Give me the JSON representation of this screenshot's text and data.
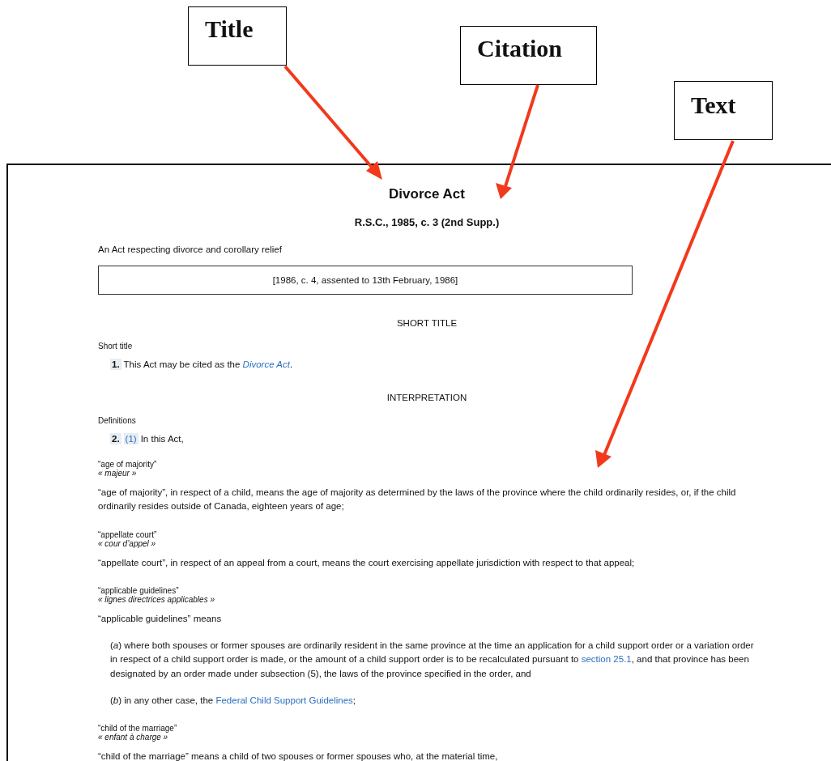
{
  "callouts": [
    {
      "label": "Title"
    },
    {
      "label": "Citation"
    },
    {
      "label": "Text"
    }
  ],
  "document": {
    "title": "Divorce Act",
    "citation": "R.S.C., 1985, c. 3 (2nd Supp.)",
    "long_title": "An Act respecting divorce and corollary relief",
    "assent": "[1986, c. 4, assented to 13th February, 1986]",
    "sections": [
      {
        "heading": "SHORT TITLE",
        "items": [
          {
            "kind": "note",
            "text": "Short title"
          },
          {
            "kind": "provision",
            "number": "1.",
            "parts": [
              {
                "kind": "plain",
                "text": "This Act may be cited as the "
              },
              {
                "kind": "link",
                "italic": true,
                "text": "Divorce Act"
              },
              {
                "kind": "plain",
                "text": "."
              }
            ]
          }
        ]
      },
      {
        "heading": "INTERPRETATION",
        "items": [
          {
            "kind": "note",
            "text": "Definitions"
          },
          {
            "kind": "provision",
            "number": "2.",
            "subsection": "(1)",
            "parts": [
              {
                "kind": "plain",
                "text": "In this Act,"
              }
            ]
          },
          {
            "kind": "definition",
            "term": "“age of majority”",
            "french": "« majeur »",
            "parts": [
              {
                "kind": "plain",
                "text": "“age of majority”, in respect of a child, means the age of majority as determined by the laws of the province where the child ordinarily resides, or, if the child ordinarily resides outside of Canada, eighteen years of age;"
              }
            ]
          },
          {
            "kind": "definition",
            "term": "“appellate court”",
            "french": "« cour d’appel »",
            "parts": [
              {
                "kind": "plain",
                "text": "“appellate court”, in respect of an appeal from a court, means the court exercising appellate jurisdiction with respect to that appeal;"
              }
            ]
          },
          {
            "kind": "definition",
            "term": "“applicable guidelines”",
            "french": "« lignes directrices applicables »",
            "parts": [
              {
                "kind": "plain",
                "text": "“applicable guidelines” means"
              }
            ]
          },
          {
            "kind": "paragraph",
            "parts": [
              {
                "kind": "plain",
                "text": "(*a*) where both spouses or former spouses are ordinarily resident in the same province at the time an application for a child support order or a variation order in respect of a child support order is made, or the amount of a child support order is to be recalculated pursuant to "
              },
              {
                "kind": "link",
                "italic": false,
                "text": "section 25.1"
              },
              {
                "kind": "plain",
                "text": ", and that province has been designated by an order made under subsection (5), the laws of the province specified in the order, and"
              }
            ]
          },
          {
            "kind": "paragraph",
            "parts": [
              {
                "kind": "plain",
                "text": "(*b*) in any other case, the "
              },
              {
                "kind": "link",
                "italic": false,
                "text": "Federal Child Support Guidelines"
              },
              {
                "kind": "plain",
                "text": ";"
              }
            ]
          },
          {
            "kind": "definition",
            "term": "“child of the marriage”",
            "french": "« enfant à charge »",
            "parts": [
              {
                "kind": "plain",
                "text": "“child of the marriage” means a child of two spouses or former spouses who, at the material time,"
              }
            ]
          }
        ]
      }
    ]
  }
}
